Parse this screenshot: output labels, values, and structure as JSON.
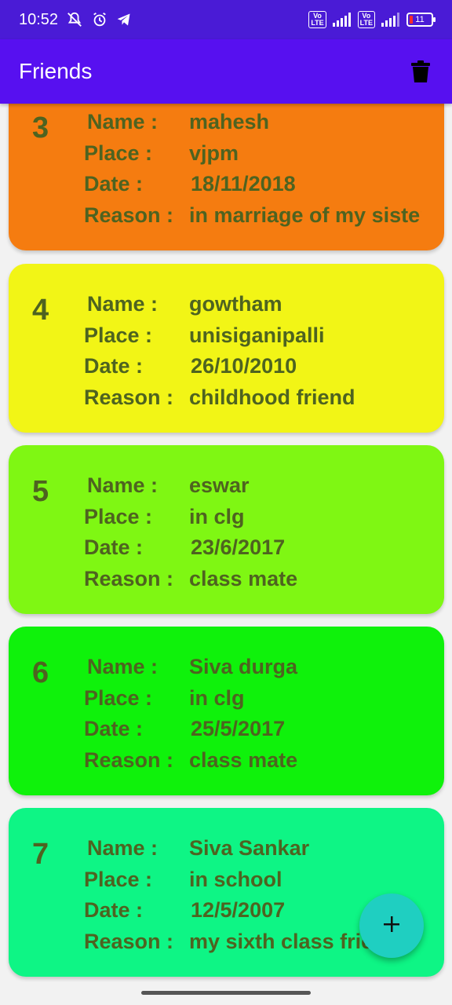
{
  "status_bar": {
    "time": "10:52",
    "volte_1": "Vo\nLTE",
    "volte_2": "Vo\nLTE",
    "battery_level": "11"
  },
  "app_bar": {
    "title": "Friends",
    "delete_icon": "trash-icon"
  },
  "labels": {
    "name": "Name :",
    "place": "Place :",
    "date": "Date :",
    "reason": "Reason :"
  },
  "friends": [
    {
      "number": "3",
      "name": "mahesh",
      "place": "vjpm",
      "date": "18/11/2018",
      "reason": "in marriage of my sister",
      "color": "#f57c10"
    },
    {
      "number": "4",
      "name": "gowtham",
      "place": "unisiganipalli",
      "date": "26/10/2010",
      "reason": "childhood friend",
      "color": "#f2f516"
    },
    {
      "number": "5",
      "name": "eswar",
      "place": "in clg",
      "date": "23/6/2017",
      "reason": "class mate",
      "color": "#7ff713"
    },
    {
      "number": "6",
      "name": "Siva durga",
      "place": "in clg",
      "date": "25/5/2017",
      "reason": "class mate",
      "color": "#0ff20b"
    },
    {
      "number": "7",
      "name": "Siva Sankar",
      "place": "in school",
      "date": "12/5/2007",
      "reason": "my sixth class friend",
      "color": "#0ef585"
    }
  ],
  "fab": {
    "icon": "plus-icon"
  }
}
